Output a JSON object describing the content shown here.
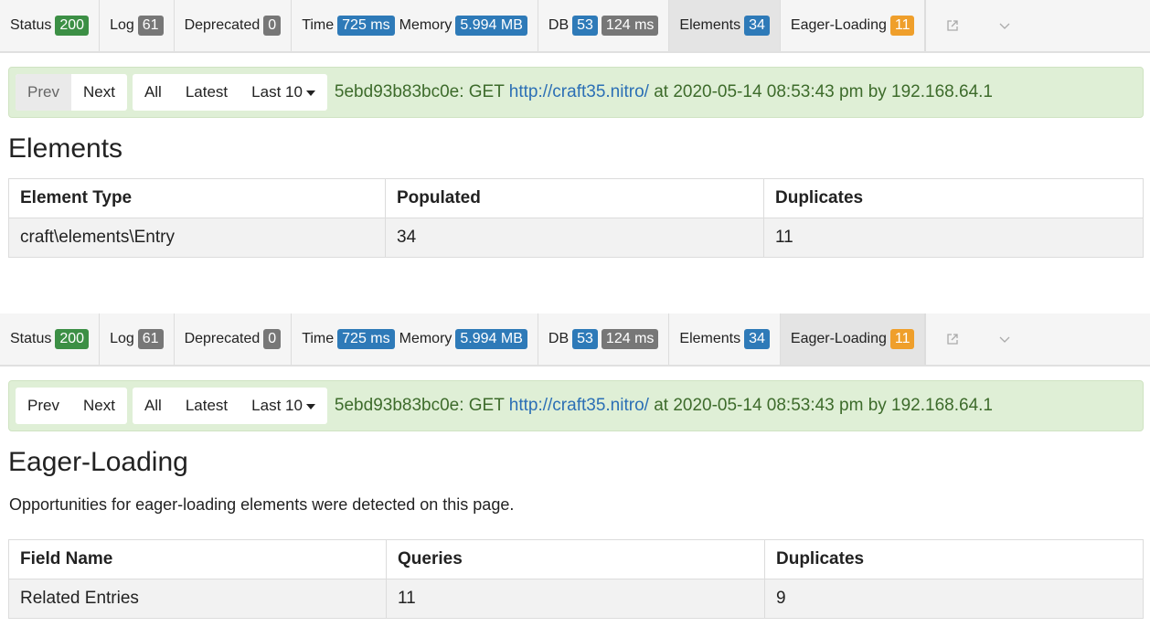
{
  "toolbar": {
    "status_label": "Status",
    "status_value": "200",
    "log_label": "Log",
    "log_value": "61",
    "deprecated_label": "Deprecated",
    "deprecated_value": "0",
    "time_label": "Time",
    "time_value": "725 ms",
    "memory_label": "Memory",
    "memory_value": "5.994 MB",
    "db_label": "DB",
    "db_count": "53",
    "db_time": "124 ms",
    "elements_label": "Elements",
    "elements_value": "34",
    "eager_label": "Eager-Loading",
    "eager_value": "11",
    "popout_icon": "external-link-icon",
    "collapse_icon": "chevron-down-icon",
    "colors": {
      "green": "#3c8f45",
      "gray": "#777777",
      "blue": "#2e7ab8",
      "orange": "#ef9f2b"
    }
  },
  "summary": {
    "prev": "Prev",
    "next": "Next",
    "all": "All",
    "latest": "Latest",
    "last10": "Last 10",
    "tag": "5ebd93b83bc0e: GET ",
    "url": "http://craft35.nitro/",
    "suffix": " at 2020-05-14 08:53:43 pm by 192.168.64.1"
  },
  "elements_panel": {
    "title": "Elements",
    "headers": [
      "Element Type",
      "Populated",
      "Duplicates"
    ],
    "rows": [
      [
        "craft\\elements\\Entry",
        "34",
        "11"
      ]
    ]
  },
  "eager_panel": {
    "title": "Eager-Loading",
    "description": "Opportunities for eager-loading elements were detected on this page.",
    "headers": [
      "Field Name",
      "Queries",
      "Duplicates"
    ],
    "rows": [
      [
        "Related Entries",
        "11",
        "9"
      ]
    ]
  }
}
